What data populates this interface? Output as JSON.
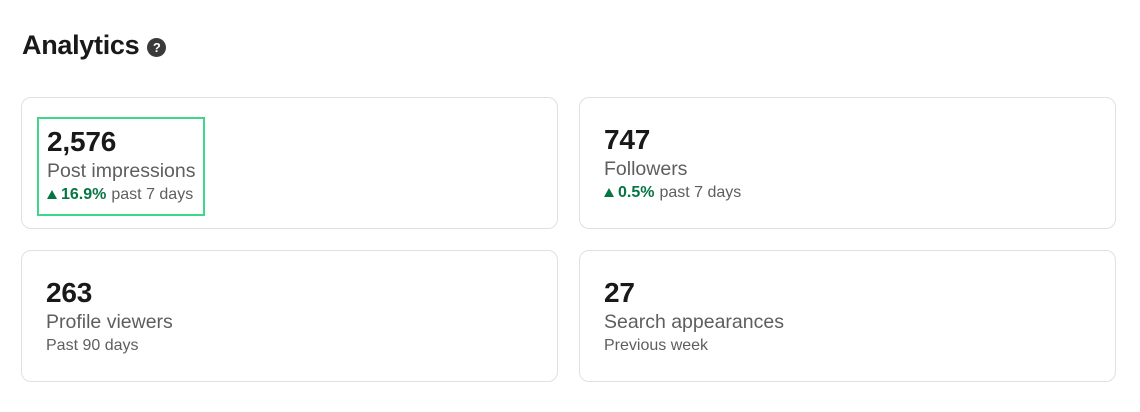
{
  "header": {
    "title": "Analytics",
    "help_icon": "question-circle-icon"
  },
  "colors": {
    "trend_up": "#057642",
    "highlight_border": "#3fd68a"
  },
  "cards": [
    {
      "value": "2,576",
      "label": "Post impressions",
      "trend": {
        "direction": "up",
        "percent": "16.9%",
        "period": "past 7 days"
      }
    },
    {
      "value": "747",
      "label": "Followers",
      "trend": {
        "direction": "up",
        "percent": "0.5%",
        "period": "past 7 days"
      }
    },
    {
      "value": "263",
      "label": "Profile viewers",
      "subtext": "Past 90 days"
    },
    {
      "value": "27",
      "label": "Search appearances",
      "subtext": "Previous week"
    }
  ]
}
